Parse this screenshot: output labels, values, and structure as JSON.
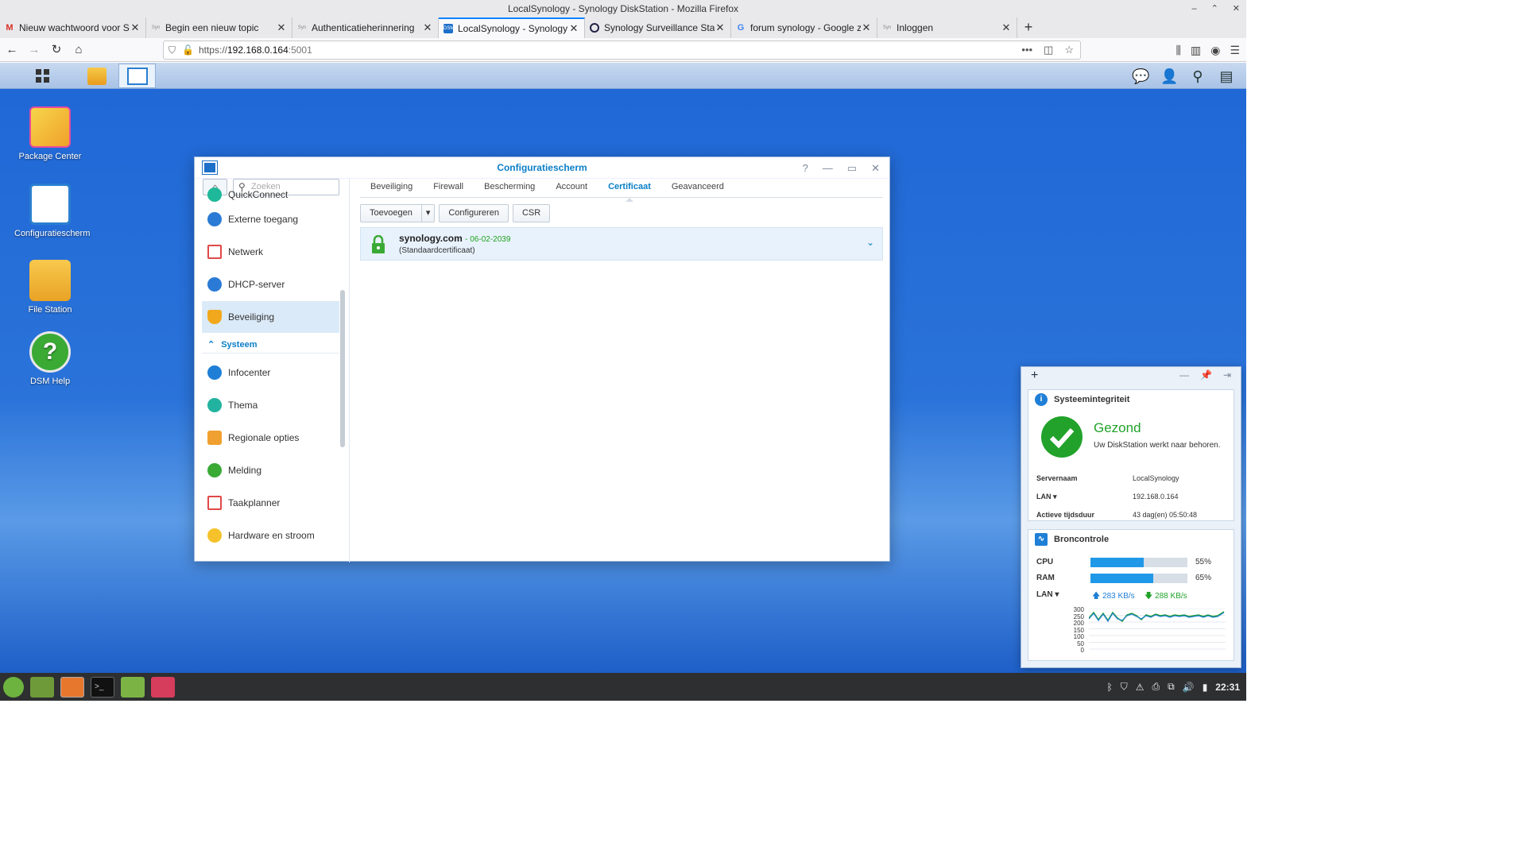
{
  "browser": {
    "title": "LocalSynology - Synology DiskStation - Mozilla Firefox",
    "tabs": [
      {
        "label": "Nieuw wachtwoord voor Sy",
        "fav": "M"
      },
      {
        "label": "Begin een nieuw topic",
        "fav": "Syn"
      },
      {
        "label": "Authenticatieherinnering",
        "fav": "Syn"
      },
      {
        "label": "LocalSynology - Synology D",
        "fav": "DSM"
      },
      {
        "label": "Synology Surveillance Stati",
        "fav": "eye"
      },
      {
        "label": "forum synology - Google zo",
        "fav": "G"
      },
      {
        "label": "Inloggen",
        "fav": "Syn"
      }
    ],
    "url_scheme": "https://",
    "url_host": "192.168.0.164",
    "url_port": ":5001"
  },
  "desktop": {
    "icons": [
      {
        "label": "Package Center"
      },
      {
        "label": "Configuratiescherm"
      },
      {
        "label": "File Station"
      },
      {
        "label": "DSM Help"
      }
    ]
  },
  "window": {
    "title": "Configuratiescherm",
    "search_placeholder": "Zoeken",
    "sidebar": {
      "items_top": [
        "QuickConnect",
        "Externe toegang",
        "Netwerk",
        "DHCP-server",
        "Beveiliging"
      ],
      "group": "Systeem",
      "items_sys": [
        "Infocenter",
        "Thema",
        "Regionale opties",
        "Melding",
        "Taakplanner",
        "Hardware en stroom"
      ]
    },
    "tabs": [
      "Beveiliging",
      "Firewall",
      "Bescherming",
      "Account",
      "Certificaat",
      "Geavanceerd"
    ],
    "toolbar": {
      "add": "Toevoegen",
      "configure": "Configureren",
      "csr": "CSR"
    },
    "certificate": {
      "name": "synology.com",
      "date": "- 06-02-2039",
      "sub": "(Standaardcertificaat)"
    }
  },
  "widget": {
    "health": {
      "title": "Systeemintegriteit",
      "status": "Gezond",
      "desc": "Uw DiskStation werkt naar behoren.",
      "server_label": "Servernaam",
      "server_value": "LocalSynology",
      "lan_label": "LAN",
      "lan_value": "192.168.0.164",
      "uptime_label": "Actieve tijdsduur",
      "uptime_value": "43 dag(en) 05:50:48"
    },
    "resource": {
      "title": "Broncontrole",
      "cpu_label": "CPU",
      "cpu_value": "55%",
      "cpu_pct": 55,
      "ram_label": "RAM",
      "ram_value": "65%",
      "ram_pct": 65,
      "lan_label": "LAN",
      "up": "283 KB/s",
      "down": "288 KB/s",
      "yticks": [
        "300",
        "250",
        "200",
        "150",
        "100",
        "50",
        "0"
      ]
    }
  },
  "clock": "22:31"
}
